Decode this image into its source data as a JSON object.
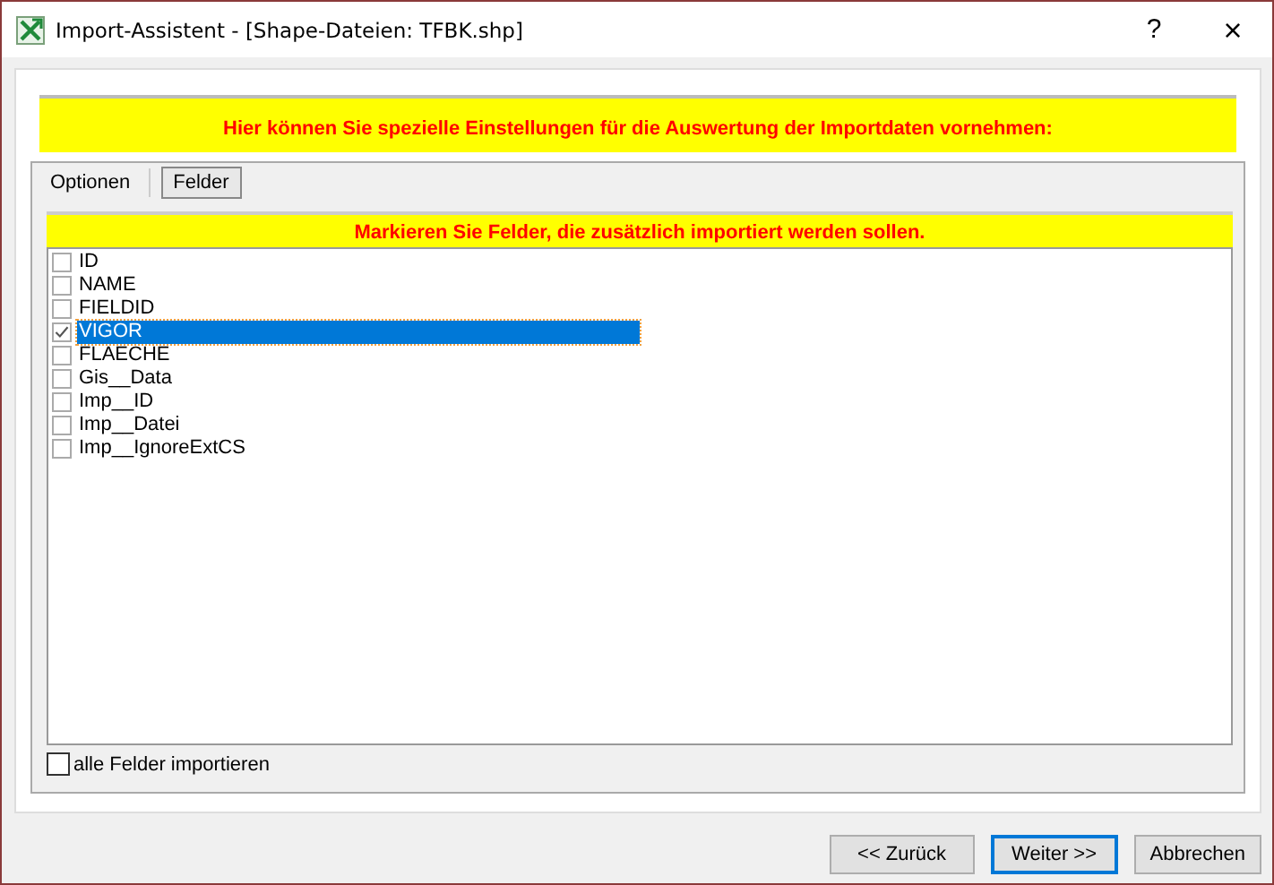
{
  "window": {
    "title": "Import-Assistent - [Shape-Dateien: TFBK.shp]",
    "help": "?",
    "close": "×"
  },
  "banner": "Hier können Sie spezielle Einstellungen für die Auswertung der Importdaten vornehmen:",
  "tabs": [
    {
      "label": "Optionen",
      "selected": false
    },
    {
      "label": "Felder",
      "selected": true
    }
  ],
  "fields_hint": "Markieren Sie Felder, die zusätzlich importiert werden sollen.",
  "fields": [
    {
      "name": "ID",
      "checked": false,
      "selected": false
    },
    {
      "name": "NAME",
      "checked": false,
      "selected": false
    },
    {
      "name": "FIELDID",
      "checked": false,
      "selected": false
    },
    {
      "name": "VIGOR",
      "checked": true,
      "selected": true
    },
    {
      "name": "FLAECHE",
      "checked": false,
      "selected": false
    },
    {
      "name": "Gis__Data",
      "checked": false,
      "selected": false
    },
    {
      "name": "Imp__ID",
      "checked": false,
      "selected": false
    },
    {
      "name": "Imp__Datei",
      "checked": false,
      "selected": false
    },
    {
      "name": "Imp__IgnoreExtCS",
      "checked": false,
      "selected": false
    }
  ],
  "import_all": {
    "label": "alle Felder importieren",
    "checked": false
  },
  "buttons": [
    {
      "label": "<<  Zurück",
      "default": false
    },
    {
      "label": "Weiter  >>",
      "default": true
    },
    {
      "label": "Abbrechen",
      "default": false
    }
  ]
}
